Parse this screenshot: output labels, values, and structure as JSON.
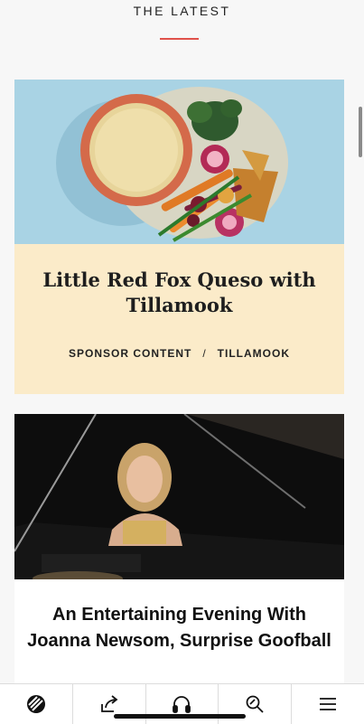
{
  "section": {
    "title": "THE LATEST"
  },
  "articles": [
    {
      "title": "Little Red Fox Queso with Tillamook",
      "category": "SPONSOR CONTENT",
      "separator": "/",
      "sponsor": "TILLAMOOK",
      "image": "queso-platter-photo"
    },
    {
      "title": "An Entertaining Evening With Joanna Newsom, Surprise Goofball",
      "image": "pianist-photo"
    }
  ],
  "tabbar": {
    "tabs": [
      {
        "icon": "logo-icon"
      },
      {
        "icon": "share-icon"
      },
      {
        "icon": "headphones-icon"
      },
      {
        "icon": "search-icon"
      },
      {
        "icon": "menu-icon"
      }
    ]
  },
  "colors": {
    "accent": "#e0514a",
    "sponsor_card_bg": "#fbebc9",
    "photo_bg_blue": "#a9d3e4"
  }
}
